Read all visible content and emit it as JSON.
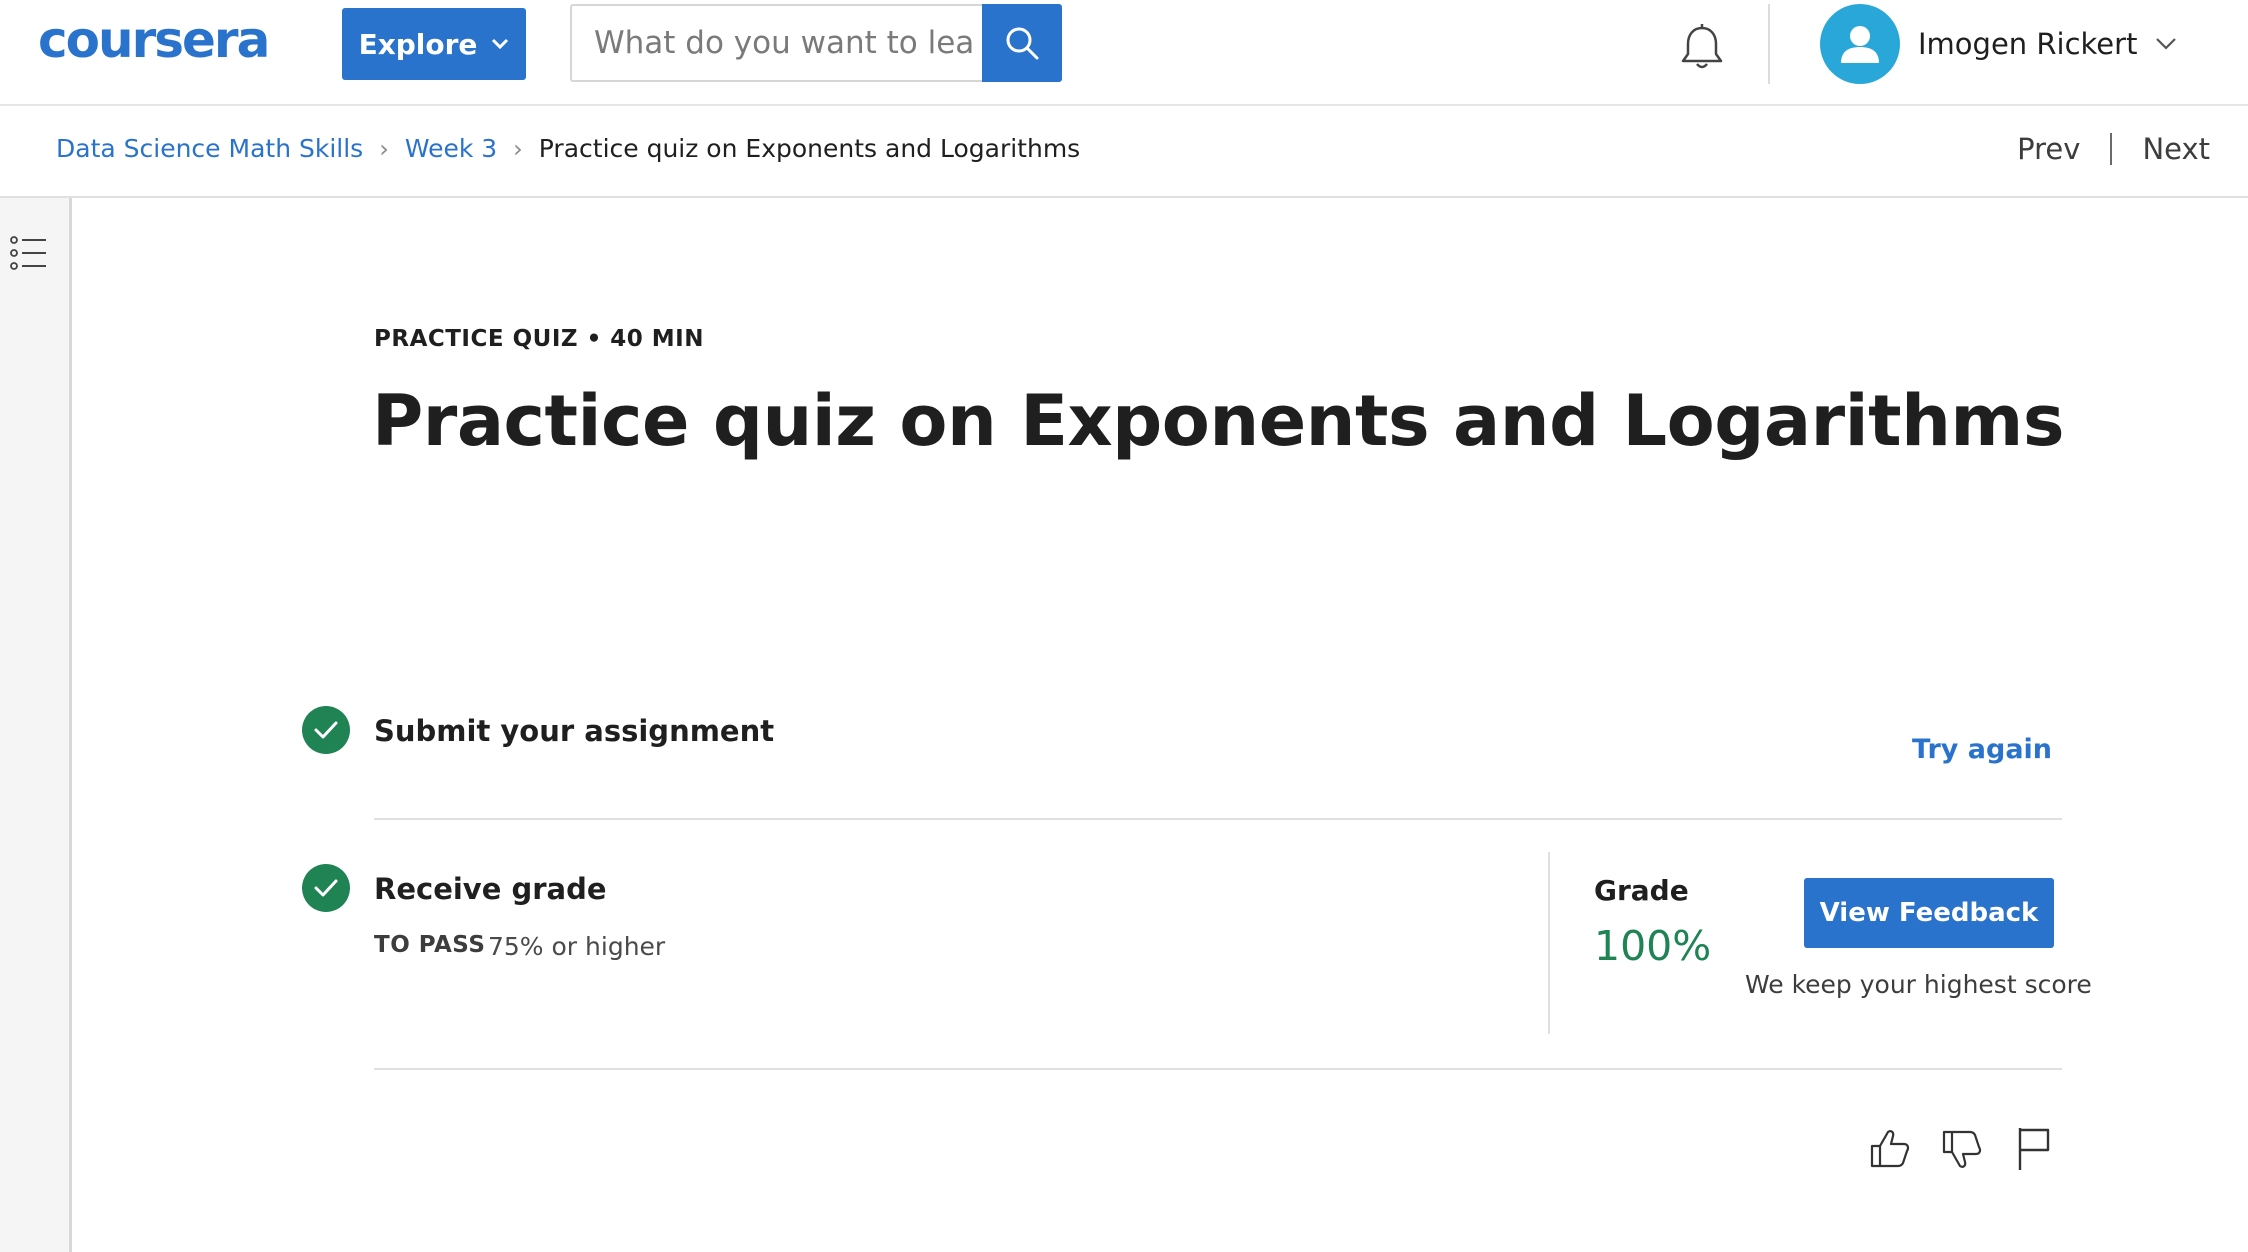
{
  "header": {
    "logo_text": "coursera",
    "explore_label": "Explore",
    "search_placeholder": "What do you want to learn?",
    "user_name": "Imogen Rickert"
  },
  "breadcrumb": {
    "items": [
      "Data Science Math Skills",
      "Week 3"
    ],
    "current": "Practice quiz on Exponents and Logarithms"
  },
  "nav": {
    "prev": "Prev",
    "next": "Next"
  },
  "content": {
    "eyebrow": "PRACTICE QUIZ • 40 MIN",
    "title": "Practice quiz on Exponents and Logarithms",
    "steps": {
      "submit": {
        "title": "Submit your assignment",
        "action": "Try again"
      },
      "receive": {
        "title": "Receive grade",
        "pass_label": "TO PASS",
        "pass_value": "75% or higher",
        "grade_label": "Grade",
        "grade_value": "100%",
        "feedback_button": "View Feedback",
        "keep_note": "We keep your highest score"
      }
    }
  },
  "colors": {
    "accent": "#2a73cc",
    "success": "#1f8354"
  },
  "icons": [
    "search-icon",
    "bell-icon",
    "user-avatar-icon",
    "chevron-down-icon",
    "menu-list-icon",
    "check-icon",
    "thumbs-up-icon",
    "thumbs-down-icon",
    "flag-icon"
  ]
}
